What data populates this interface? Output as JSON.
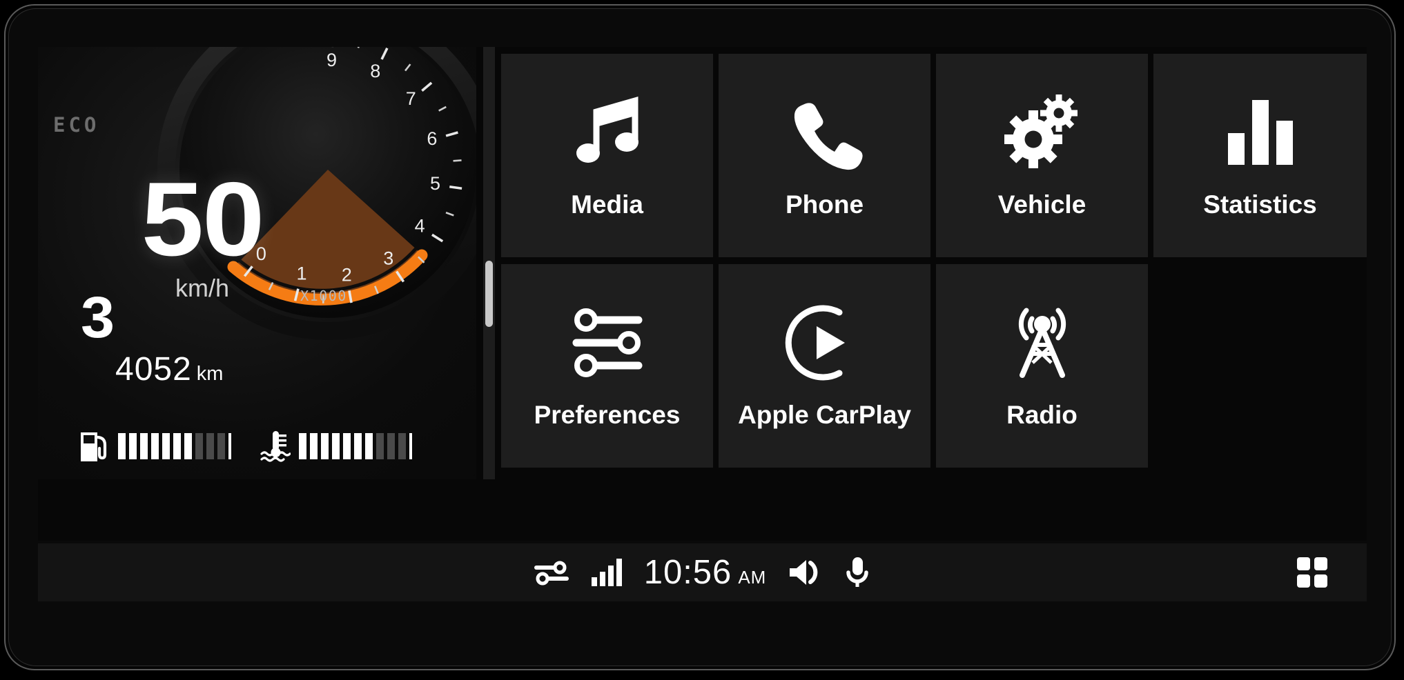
{
  "cluster": {
    "eco_label": "ECO",
    "speed_value": "50",
    "speed_unit": "km/h",
    "gear": "3",
    "odometer_value": "4052",
    "odometer_unit": "km",
    "tach_multiplier_label": "X1000",
    "tach_ticks": [
      "0",
      "1",
      "2",
      "3",
      "4",
      "5",
      "6",
      "7",
      "8",
      "9"
    ],
    "fuel": {
      "icon": "fuel-pump-icon",
      "filled_bars": 7,
      "empty_bars": 3
    },
    "temperature": {
      "icon": "coolant-temp-icon",
      "filled_bars": 7,
      "empty_bars": 3
    }
  },
  "tiles": [
    {
      "label": "Media",
      "icon": "music-note-icon"
    },
    {
      "label": "Phone",
      "icon": "phone-handset-icon"
    },
    {
      "label": "Vehicle",
      "icon": "gears-icon"
    },
    {
      "label": "Statistics",
      "icon": "bar-chart-icon"
    },
    {
      "label": "Preferences",
      "icon": "sliders-icon"
    },
    {
      "label": "Apple CarPlay",
      "icon": "carplay-play-icon"
    },
    {
      "label": "Radio",
      "icon": "radio-tower-icon"
    }
  ],
  "statusbar": {
    "settings_icon": "sliders-icon",
    "signal_icon": "signal-bars-icon",
    "time": "10:56",
    "ampm": "AM",
    "volume_icon": "speaker-volume-icon",
    "mic_icon": "microphone-icon",
    "apps_icon": "app-grid-icon"
  },
  "colors": {
    "accent_orange": "#F57C14",
    "tach_zone_brown": "#6B3A18",
    "tile_bg": "#1E1E1E",
    "screen_bg": "#070707",
    "bar_off": "#4A4A4A"
  }
}
